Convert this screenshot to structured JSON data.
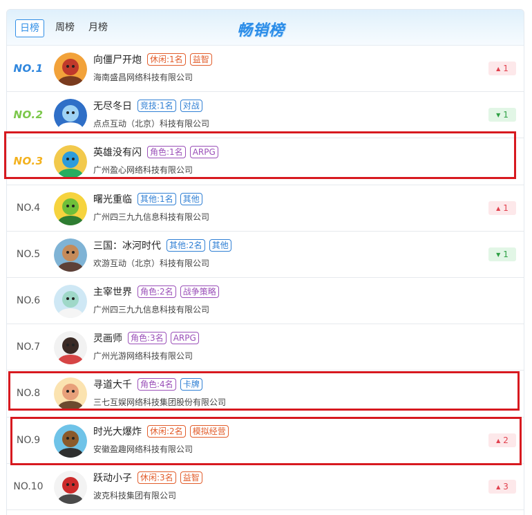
{
  "tabs": [
    "日榜",
    "周榜",
    "月榜"
  ],
  "title": "畅销榜",
  "rows": [
    {
      "rank": "NO.1",
      "name": "向僵尸开炮",
      "tags": [
        {
          "text": "休闲:1名",
          "color": "orange"
        },
        {
          "text": "益智",
          "color": "orange"
        }
      ],
      "company": "海南盛昌网络科技有限公司",
      "change": {
        "dir": "up",
        "value": "1"
      },
      "avatar_icon": "game-avatar-warrior"
    },
    {
      "rank": "NO.2",
      "name": "无尽冬日",
      "tags": [
        {
          "text": "竞技:1名",
          "color": "blue"
        },
        {
          "text": "对战",
          "color": "blue"
        }
      ],
      "company": "点点互动（北京）科技有限公司",
      "change": {
        "dir": "down",
        "value": "1"
      },
      "avatar_icon": "game-avatar-globe"
    },
    {
      "rank": "NO.3",
      "name": "英雄没有闪",
      "tags": [
        {
          "text": "角色:1名",
          "color": "purple"
        },
        {
          "text": "ARPG",
          "color": "purple"
        }
      ],
      "company": "广州盈心网络科技有限公司",
      "change": null,
      "avatar_icon": "game-avatar-hero"
    },
    {
      "rank": "NO.4",
      "name": "曙光重临",
      "tags": [
        {
          "text": "其他:1名",
          "color": "blue"
        },
        {
          "text": "其他",
          "color": "blue"
        }
      ],
      "company": "广州四三九九信息科技有限公司",
      "change": {
        "dir": "up",
        "value": "1"
      },
      "avatar_icon": "game-avatar-goblin"
    },
    {
      "rank": "NO.5",
      "name": "三国：冰河时代",
      "tags": [
        {
          "text": "其他:2名",
          "color": "blue"
        },
        {
          "text": "其他",
          "color": "blue"
        }
      ],
      "company": "欢游互动（北京）科技有限公司",
      "change": {
        "dir": "down",
        "value": "1"
      },
      "avatar_icon": "game-avatar-general"
    },
    {
      "rank": "NO.6",
      "name": "主宰世界",
      "tags": [
        {
          "text": "角色:2名",
          "color": "purple"
        },
        {
          "text": "战争策略",
          "color": "purple"
        }
      ],
      "company": "广州四三九九信息科技有限公司",
      "change": null,
      "avatar_icon": "game-avatar-elf"
    },
    {
      "rank": "NO.7",
      "name": "灵画师",
      "tags": [
        {
          "text": "角色:3名",
          "color": "purple"
        },
        {
          "text": "ARPG",
          "color": "purple"
        }
      ],
      "company": "广州光游网络科技有限公司",
      "change": null,
      "avatar_icon": "game-avatar-painter"
    },
    {
      "rank": "NO.8",
      "name": "寻道大千",
      "tags": [
        {
          "text": "角色:4名",
          "color": "purple"
        },
        {
          "text": "卡牌",
          "color": "blue"
        }
      ],
      "company": "三七互娱网络科技集团股份有限公司",
      "change": null,
      "avatar_icon": "game-avatar-monk"
    },
    {
      "rank": "NO.9",
      "name": "时光大爆炸",
      "tags": [
        {
          "text": "休闲:2名",
          "color": "orange"
        },
        {
          "text": "模拟经营",
          "color": "orange"
        }
      ],
      "company": "安徽盈趣网络科技有限公司",
      "change": {
        "dir": "up",
        "value": "2"
      },
      "avatar_icon": "game-avatar-caveman"
    },
    {
      "rank": "NO.10",
      "name": "跃动小子",
      "tags": [
        {
          "text": "休闲:3名",
          "color": "orange"
        },
        {
          "text": "益智",
          "color": "orange"
        }
      ],
      "company": "波克科技集团有限公司",
      "change": {
        "dir": "up",
        "value": "3"
      },
      "avatar_icon": "game-avatar-spartan"
    }
  ],
  "arrows": {
    "up": "▲",
    "down": "▼"
  }
}
